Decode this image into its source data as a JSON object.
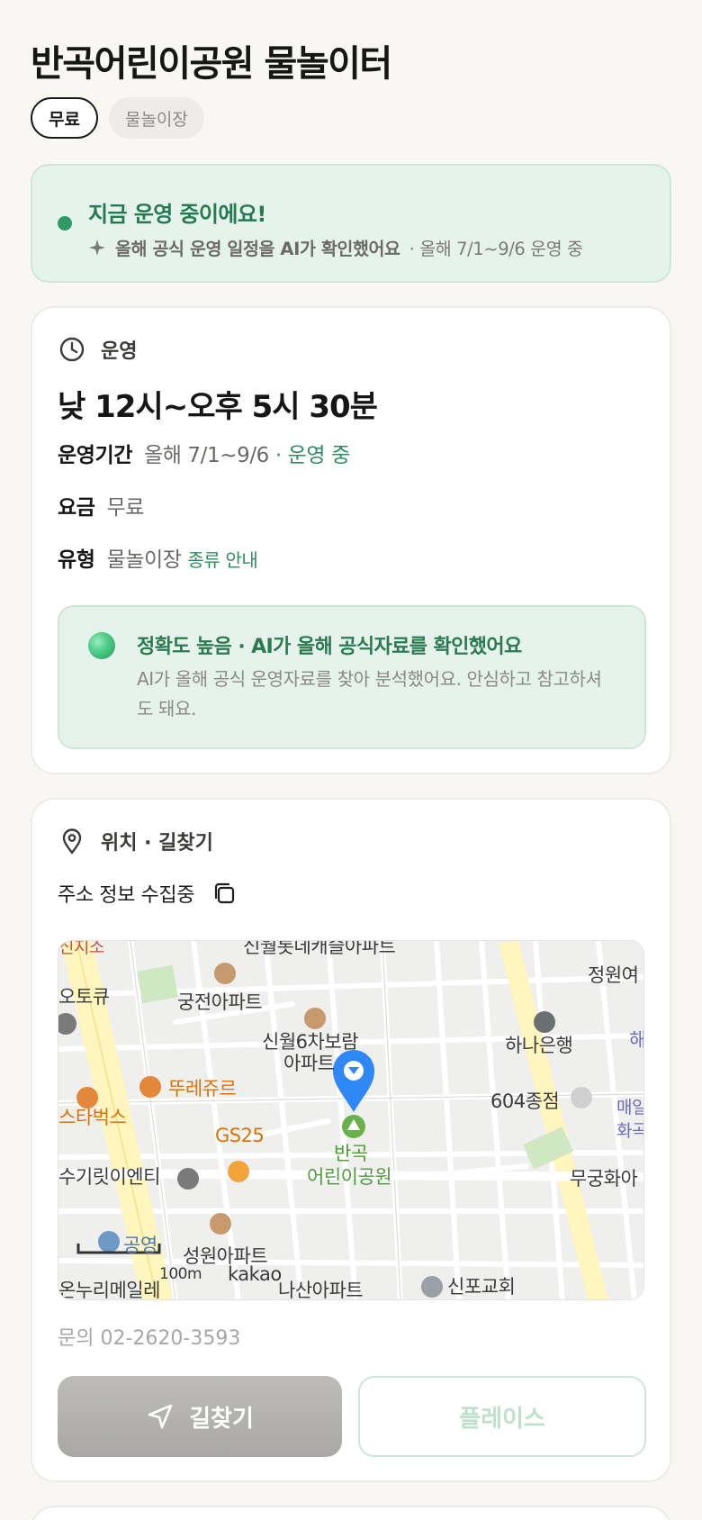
{
  "header": {
    "title": "반곡어린이공원 물놀이터"
  },
  "tags": {
    "fee": "무료",
    "type": "물놀이장"
  },
  "status": {
    "title": "지금 운영 중이에요!",
    "ai_note": "올해 공식 운영 일정을 AI가 확인했어요",
    "period_note": "· 올해 7/1~9/6 운영 중"
  },
  "operation": {
    "heading": "운영",
    "hours": "낮 12시~오후 5시 30분",
    "period_label": "운영기간",
    "period_value": "올해 7/1~9/6",
    "period_status": "· 운영 중",
    "fee_label": "요금",
    "fee_value": "무료",
    "type_label": "유형",
    "type_value": "물놀이장",
    "type_link": "종류 안내",
    "accuracy_title": "정확도 높음 · AI가 올해 공식자료를 확인했어요",
    "accuracy_desc": "AI가 올해 공식 운영자료를 찾아 분석했어요. 안심하고 참고하셔도 돼요."
  },
  "location": {
    "heading": "위치 · 길찾기",
    "address": "주소 정보 수집중",
    "contact": "문의 02-2620-3593",
    "route_button": "길찾기",
    "place_button": "플레이스"
  },
  "map": {
    "labels": {
      "top_cut": "신지소",
      "top_apt": "신월롯데캐슬아파트",
      "jeongwon": "정원여",
      "otokyu": "오토큐",
      "gungjeon": "궁전아파트",
      "sinwol": "신월6차보람",
      "sinwol2": "아파트",
      "hana": "하나은행",
      "hae": "해",
      "ttureju": "뚜레쥬르",
      "starbucks": "스타벅스",
      "dept604": "604종점",
      "maeul": "매일",
      "hwa": "화곡",
      "gs25": "GS25",
      "park1": "반곡",
      "park2": "어린이공원",
      "sugi": "수기릿이엔티",
      "mugung": "무궁화아",
      "parking": "공영",
      "seongwon": "성원아파트",
      "kakao": "kakao",
      "scale": "100m",
      "nuri": "온누리메일레",
      "nasan": "나산아파트",
      "sinpo": "신포교회"
    },
    "colors": {
      "road": "#ffffff",
      "major_road": "#fff5bf",
      "block": "#efefed",
      "park": "#cfe7c3",
      "pin": "#2f88f5"
    }
  },
  "colors": {
    "accent": "#2f8c5e",
    "banner_bg": "#e6f2ec"
  }
}
